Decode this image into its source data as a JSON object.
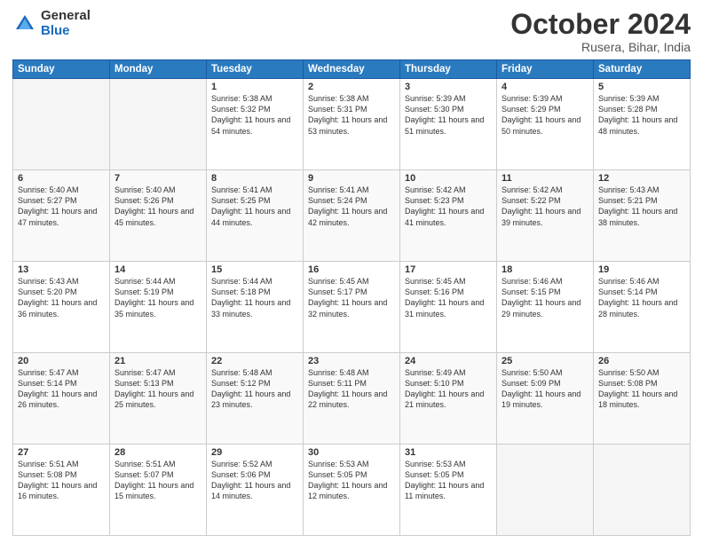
{
  "header": {
    "logo_general": "General",
    "logo_blue": "Blue",
    "title": "October 2024",
    "location": "Rusera, Bihar, India"
  },
  "days_of_week": [
    "Sunday",
    "Monday",
    "Tuesday",
    "Wednesday",
    "Thursday",
    "Friday",
    "Saturday"
  ],
  "weeks": [
    [
      {
        "day": "",
        "sunrise": "",
        "sunset": "",
        "daylight": ""
      },
      {
        "day": "",
        "sunrise": "",
        "sunset": "",
        "daylight": ""
      },
      {
        "day": "1",
        "sunrise": "Sunrise: 5:38 AM",
        "sunset": "Sunset: 5:32 PM",
        "daylight": "Daylight: 11 hours and 54 minutes."
      },
      {
        "day": "2",
        "sunrise": "Sunrise: 5:38 AM",
        "sunset": "Sunset: 5:31 PM",
        "daylight": "Daylight: 11 hours and 53 minutes."
      },
      {
        "day": "3",
        "sunrise": "Sunrise: 5:39 AM",
        "sunset": "Sunset: 5:30 PM",
        "daylight": "Daylight: 11 hours and 51 minutes."
      },
      {
        "day": "4",
        "sunrise": "Sunrise: 5:39 AM",
        "sunset": "Sunset: 5:29 PM",
        "daylight": "Daylight: 11 hours and 50 minutes."
      },
      {
        "day": "5",
        "sunrise": "Sunrise: 5:39 AM",
        "sunset": "Sunset: 5:28 PM",
        "daylight": "Daylight: 11 hours and 48 minutes."
      }
    ],
    [
      {
        "day": "6",
        "sunrise": "Sunrise: 5:40 AM",
        "sunset": "Sunset: 5:27 PM",
        "daylight": "Daylight: 11 hours and 47 minutes."
      },
      {
        "day": "7",
        "sunrise": "Sunrise: 5:40 AM",
        "sunset": "Sunset: 5:26 PM",
        "daylight": "Daylight: 11 hours and 45 minutes."
      },
      {
        "day": "8",
        "sunrise": "Sunrise: 5:41 AM",
        "sunset": "Sunset: 5:25 PM",
        "daylight": "Daylight: 11 hours and 44 minutes."
      },
      {
        "day": "9",
        "sunrise": "Sunrise: 5:41 AM",
        "sunset": "Sunset: 5:24 PM",
        "daylight": "Daylight: 11 hours and 42 minutes."
      },
      {
        "day": "10",
        "sunrise": "Sunrise: 5:42 AM",
        "sunset": "Sunset: 5:23 PM",
        "daylight": "Daylight: 11 hours and 41 minutes."
      },
      {
        "day": "11",
        "sunrise": "Sunrise: 5:42 AM",
        "sunset": "Sunset: 5:22 PM",
        "daylight": "Daylight: 11 hours and 39 minutes."
      },
      {
        "day": "12",
        "sunrise": "Sunrise: 5:43 AM",
        "sunset": "Sunset: 5:21 PM",
        "daylight": "Daylight: 11 hours and 38 minutes."
      }
    ],
    [
      {
        "day": "13",
        "sunrise": "Sunrise: 5:43 AM",
        "sunset": "Sunset: 5:20 PM",
        "daylight": "Daylight: 11 hours and 36 minutes."
      },
      {
        "day": "14",
        "sunrise": "Sunrise: 5:44 AM",
        "sunset": "Sunset: 5:19 PM",
        "daylight": "Daylight: 11 hours and 35 minutes."
      },
      {
        "day": "15",
        "sunrise": "Sunrise: 5:44 AM",
        "sunset": "Sunset: 5:18 PM",
        "daylight": "Daylight: 11 hours and 33 minutes."
      },
      {
        "day": "16",
        "sunrise": "Sunrise: 5:45 AM",
        "sunset": "Sunset: 5:17 PM",
        "daylight": "Daylight: 11 hours and 32 minutes."
      },
      {
        "day": "17",
        "sunrise": "Sunrise: 5:45 AM",
        "sunset": "Sunset: 5:16 PM",
        "daylight": "Daylight: 11 hours and 31 minutes."
      },
      {
        "day": "18",
        "sunrise": "Sunrise: 5:46 AM",
        "sunset": "Sunset: 5:15 PM",
        "daylight": "Daylight: 11 hours and 29 minutes."
      },
      {
        "day": "19",
        "sunrise": "Sunrise: 5:46 AM",
        "sunset": "Sunset: 5:14 PM",
        "daylight": "Daylight: 11 hours and 28 minutes."
      }
    ],
    [
      {
        "day": "20",
        "sunrise": "Sunrise: 5:47 AM",
        "sunset": "Sunset: 5:14 PM",
        "daylight": "Daylight: 11 hours and 26 minutes."
      },
      {
        "day": "21",
        "sunrise": "Sunrise: 5:47 AM",
        "sunset": "Sunset: 5:13 PM",
        "daylight": "Daylight: 11 hours and 25 minutes."
      },
      {
        "day": "22",
        "sunrise": "Sunrise: 5:48 AM",
        "sunset": "Sunset: 5:12 PM",
        "daylight": "Daylight: 11 hours and 23 minutes."
      },
      {
        "day": "23",
        "sunrise": "Sunrise: 5:48 AM",
        "sunset": "Sunset: 5:11 PM",
        "daylight": "Daylight: 11 hours and 22 minutes."
      },
      {
        "day": "24",
        "sunrise": "Sunrise: 5:49 AM",
        "sunset": "Sunset: 5:10 PM",
        "daylight": "Daylight: 11 hours and 21 minutes."
      },
      {
        "day": "25",
        "sunrise": "Sunrise: 5:50 AM",
        "sunset": "Sunset: 5:09 PM",
        "daylight": "Daylight: 11 hours and 19 minutes."
      },
      {
        "day": "26",
        "sunrise": "Sunrise: 5:50 AM",
        "sunset": "Sunset: 5:08 PM",
        "daylight": "Daylight: 11 hours and 18 minutes."
      }
    ],
    [
      {
        "day": "27",
        "sunrise": "Sunrise: 5:51 AM",
        "sunset": "Sunset: 5:08 PM",
        "daylight": "Daylight: 11 hours and 16 minutes."
      },
      {
        "day": "28",
        "sunrise": "Sunrise: 5:51 AM",
        "sunset": "Sunset: 5:07 PM",
        "daylight": "Daylight: 11 hours and 15 minutes."
      },
      {
        "day": "29",
        "sunrise": "Sunrise: 5:52 AM",
        "sunset": "Sunset: 5:06 PM",
        "daylight": "Daylight: 11 hours and 14 minutes."
      },
      {
        "day": "30",
        "sunrise": "Sunrise: 5:53 AM",
        "sunset": "Sunset: 5:05 PM",
        "daylight": "Daylight: 11 hours and 12 minutes."
      },
      {
        "day": "31",
        "sunrise": "Sunrise: 5:53 AM",
        "sunset": "Sunset: 5:05 PM",
        "daylight": "Daylight: 11 hours and 11 minutes."
      },
      {
        "day": "",
        "sunrise": "",
        "sunset": "",
        "daylight": ""
      },
      {
        "day": "",
        "sunrise": "",
        "sunset": "",
        "daylight": ""
      }
    ]
  ]
}
